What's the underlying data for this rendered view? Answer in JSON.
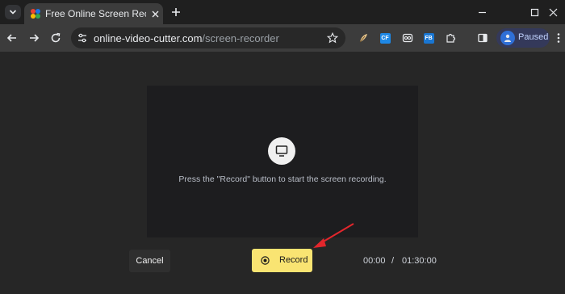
{
  "browser": {
    "tab": {
      "title": "Free Online Screen Recorder"
    },
    "url": {
      "host": "online-video-cutter.com",
      "path": "/screen-recorder"
    },
    "profile": {
      "label": "Paused"
    },
    "extensions": [
      {
        "icon": "feather-extension-icon",
        "label": ""
      },
      {
        "icon": "cf-extension-icon",
        "label": "CF",
        "color": "#1e88e5"
      },
      {
        "icon": "loop-extension-icon",
        "label": "",
        "color": "#e8eaed"
      },
      {
        "icon": "fb-extension-icon",
        "label": "FB",
        "color": "#1976d2"
      }
    ]
  },
  "page": {
    "hint": "Press the \"Record\" button to start the screen recording.",
    "cancel_label": "Cancel",
    "record_label": "Record",
    "time_elapsed": "00:00",
    "time_separator": "/",
    "time_limit": "01:30:00"
  },
  "colors": {
    "record_button": "#f9e472",
    "annotation_arrow": "#e3262c"
  }
}
